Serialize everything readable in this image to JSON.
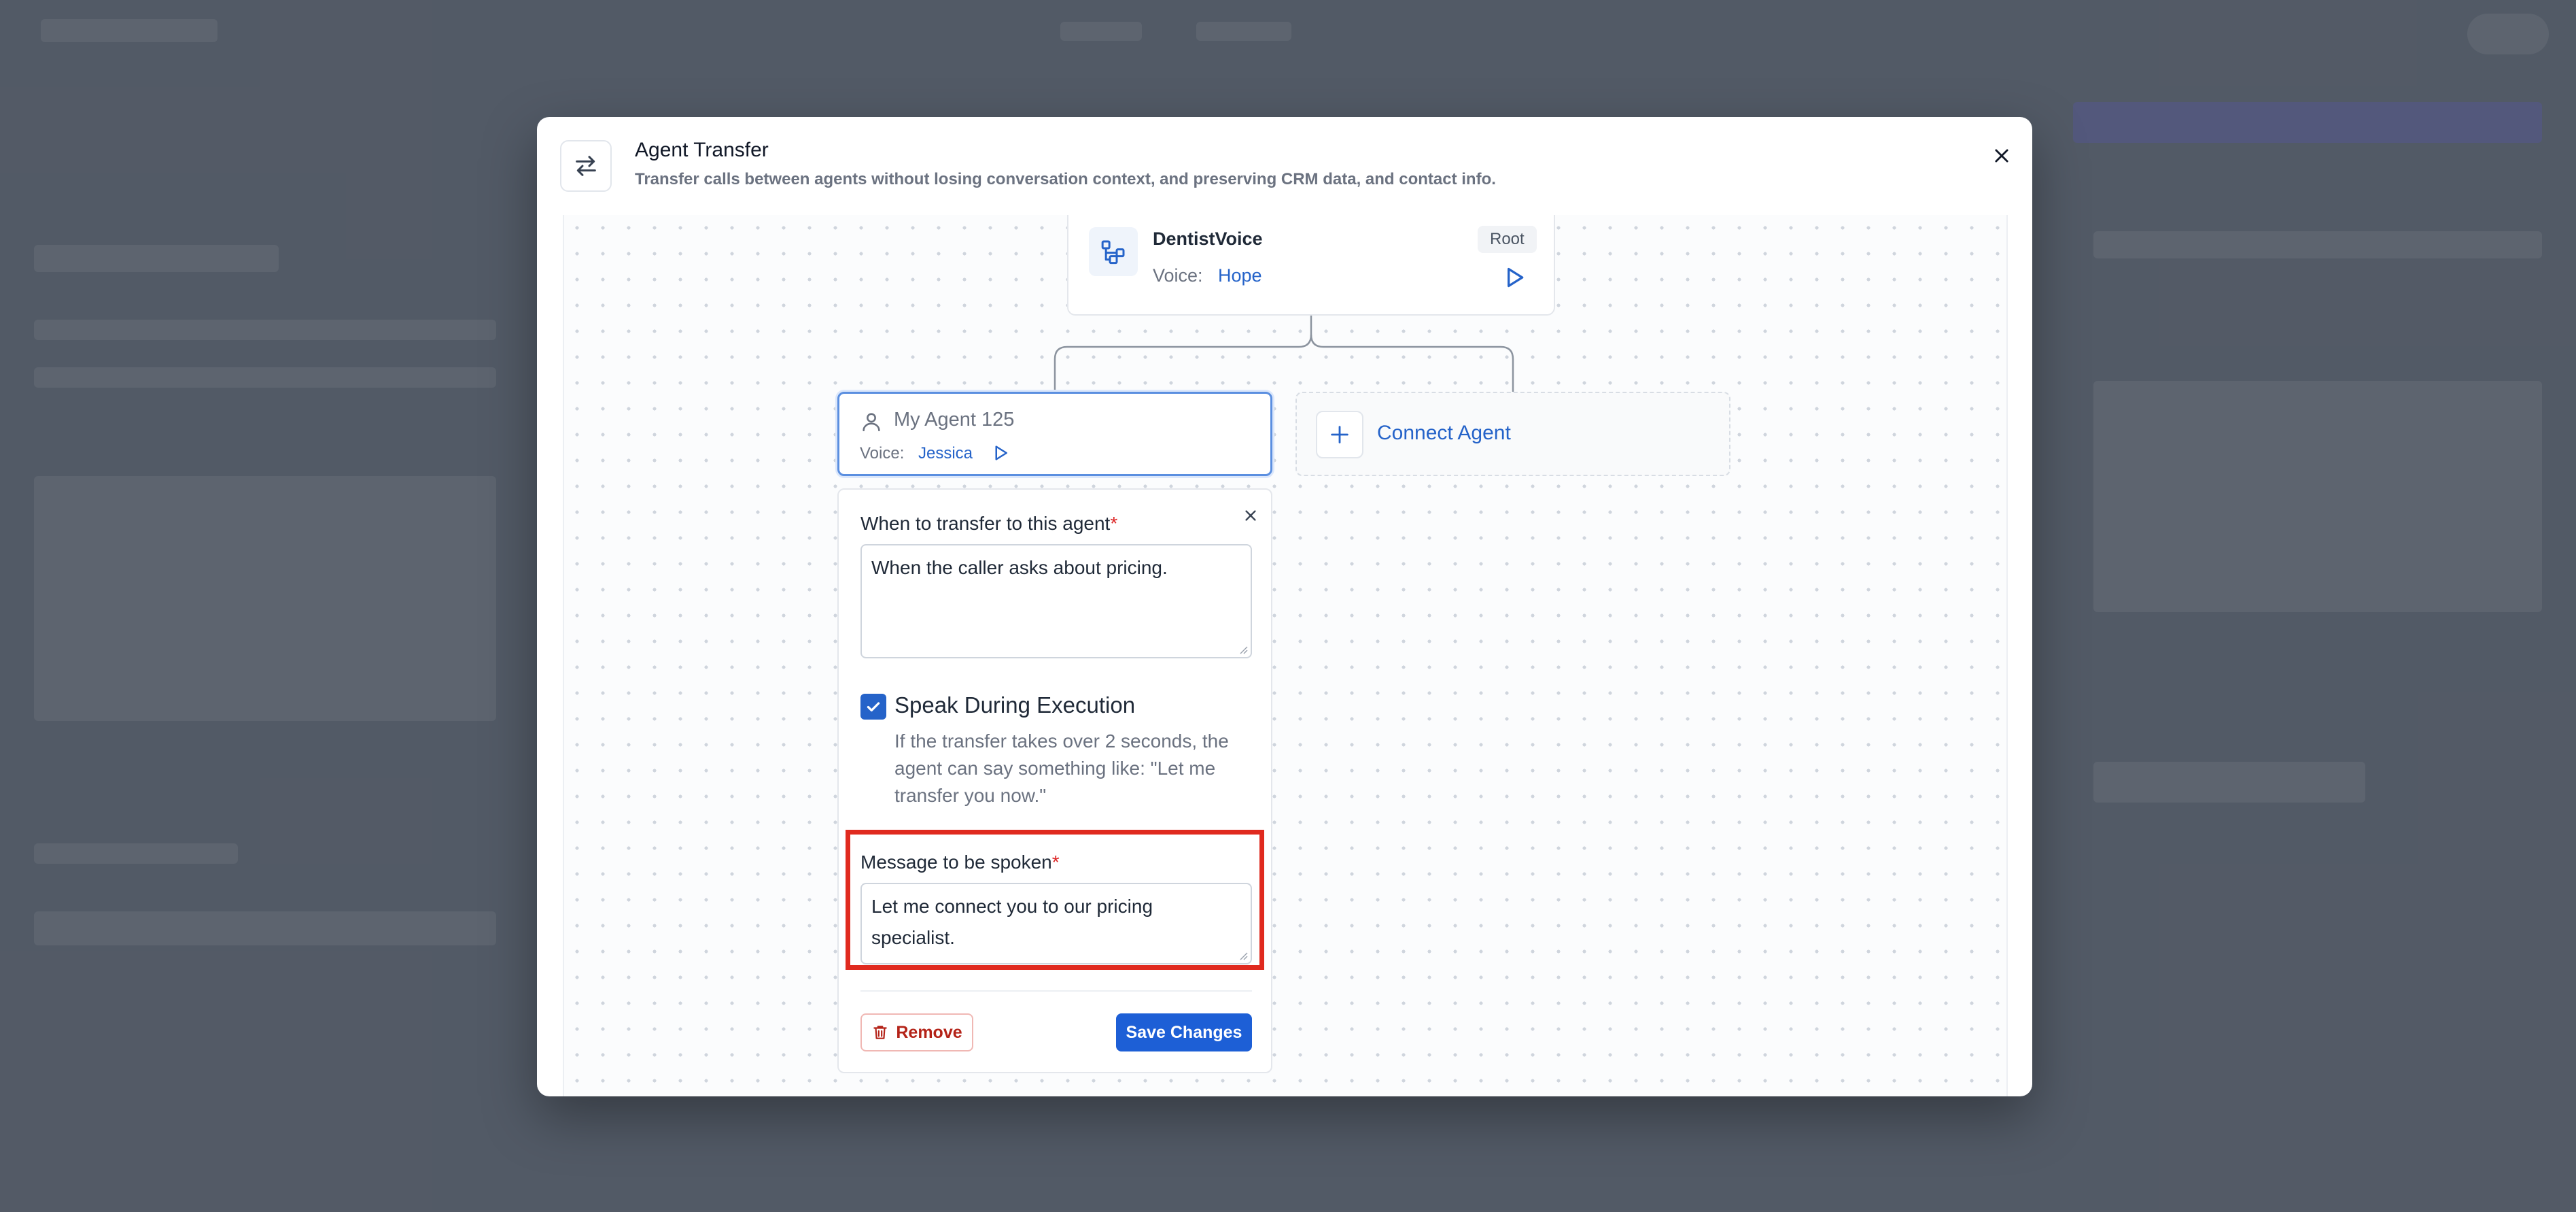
{
  "modal": {
    "title": "Agent Transfer",
    "subtitle": "Transfer calls between agents without losing conversation context, and preserving CRM data, and contact info.",
    "header_icon": "arrows-swap-icon",
    "close_icon": "close-icon"
  },
  "root_agent": {
    "name": "DentistVoice",
    "badge": "Root",
    "voice_label": "Voice:",
    "voice_value": "Hope",
    "icon": "flow-tree-icon"
  },
  "child_agent": {
    "name": "My Agent 125",
    "voice_label": "Voice:",
    "voice_value": "Jessica",
    "icon": "user-icon"
  },
  "connect_agent": {
    "label": "Connect Agent"
  },
  "transfer_form": {
    "when_label": "When to transfer to this agent",
    "when_required": "*",
    "when_value": "When the caller asks about pricing.",
    "speak_label": "Speak During Execution",
    "speak_checked": true,
    "speak_help": "If the transfer takes over 2 seconds, the agent can say something like: \"Let me transfer you now.\"",
    "message_label": "Message to be spoken",
    "message_required": "*",
    "message_value": "Let me connect you to our pricing specialist.",
    "remove_label": "Remove",
    "save_label": "Save Changes"
  },
  "colors": {
    "accent": "#2563c9",
    "danger": "#b42318",
    "highlight": "#e02a1f"
  }
}
